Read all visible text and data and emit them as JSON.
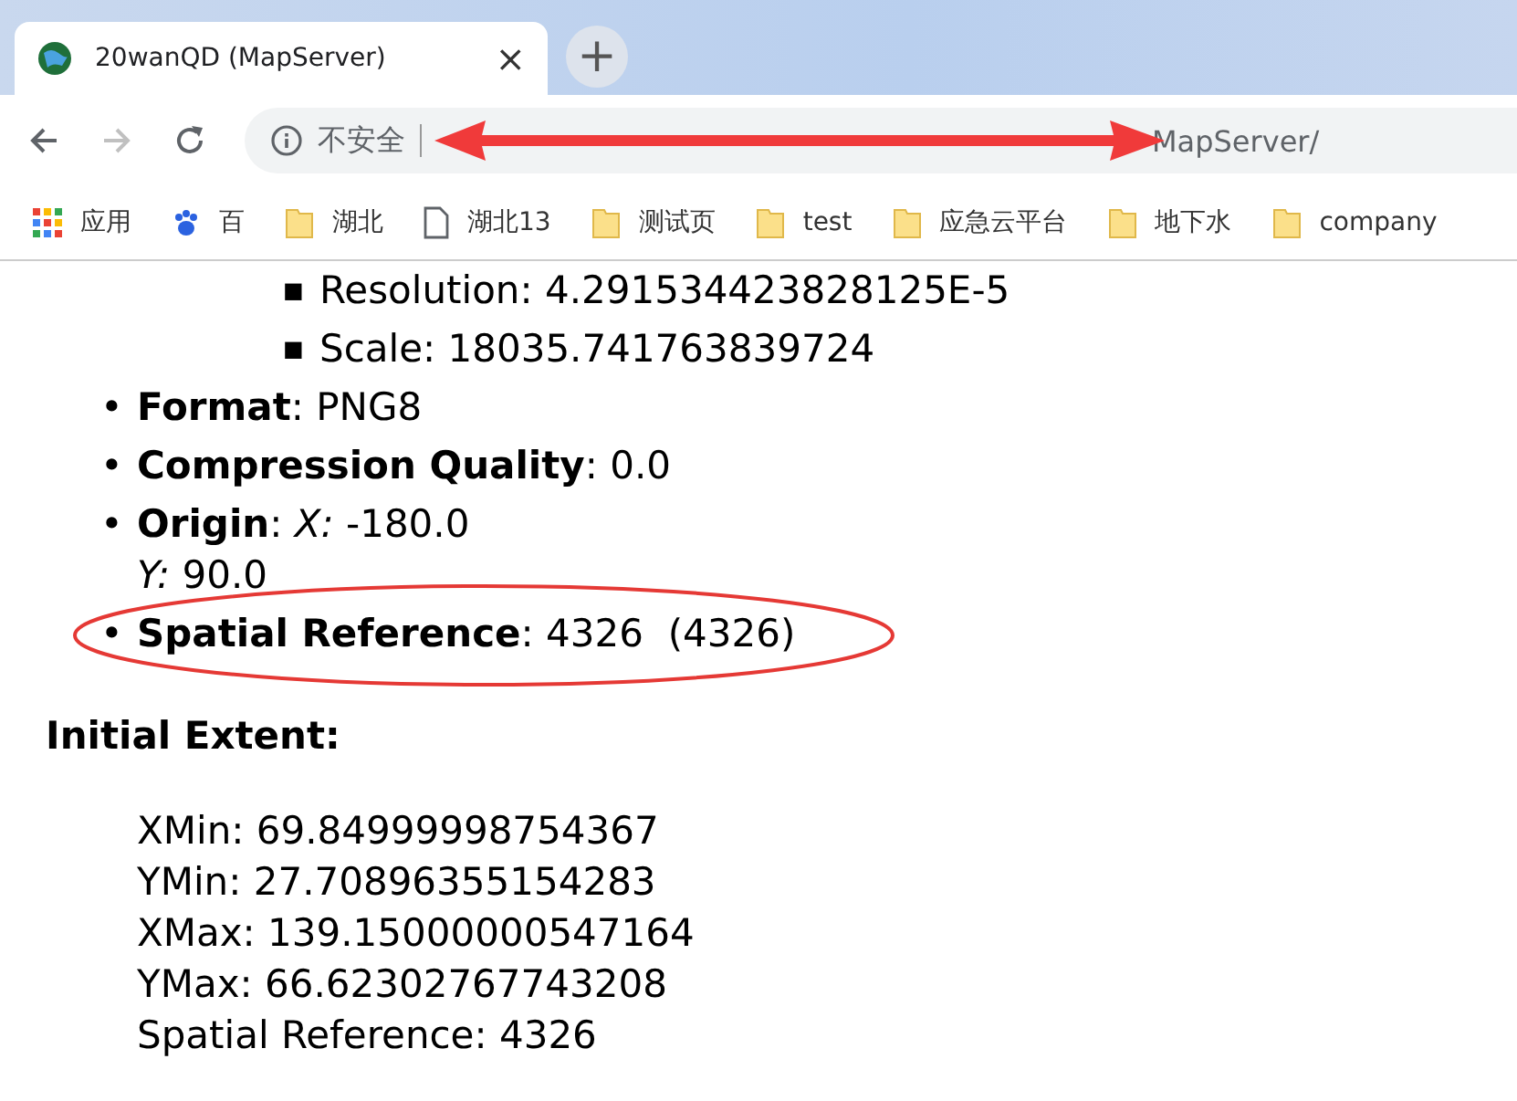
{
  "tab": {
    "title": "20wanQD (MapServer)",
    "close": "×",
    "new_tab": "+"
  },
  "address": {
    "security_label": "不安全",
    "url": "MapServer/"
  },
  "bookmarks": [
    {
      "kind": "apps",
      "label": "应用"
    },
    {
      "kind": "paw",
      "label": "百"
    },
    {
      "kind": "folder",
      "label": "湖北"
    },
    {
      "kind": "page",
      "label": "湖北13"
    },
    {
      "kind": "folder",
      "label": "测试页"
    },
    {
      "kind": "folder",
      "label": "test"
    },
    {
      "kind": "folder",
      "label": "应急云平台"
    },
    {
      "kind": "folder",
      "label": "地下水"
    },
    {
      "kind": "folder",
      "label": "company"
    }
  ],
  "sub_items": [
    {
      "marker": "■",
      "text": "Resolution: 4.291534423828125E-5"
    },
    {
      "marker": "■",
      "text": "Scale: 18035.741763839724"
    }
  ],
  "items": [
    {
      "marker": "•",
      "lines": [
        "**Format**: PNG8"
      ],
      "circled": false
    },
    {
      "marker": "•",
      "lines": [
        "**Compression Quality**: 0.0"
      ],
      "circled": false
    },
    {
      "marker": "•",
      "lines": [
        "**Origin**: *X:* -180.0",
        "*Y:* 90.0"
      ],
      "circled": false
    },
    {
      "marker": "•",
      "lines": [
        "**Spatial Reference**: 4326  (4326)"
      ],
      "circled": true
    }
  ],
  "extent": {
    "heading": "Initial Extent:",
    "lines": [
      "XMin: 69.84999998754367",
      "YMin: 27.70896355154283",
      "XMax: 139.15000000547164",
      "YMax: 66.62302767743208",
      "Spatial Reference: 4326"
    ]
  }
}
